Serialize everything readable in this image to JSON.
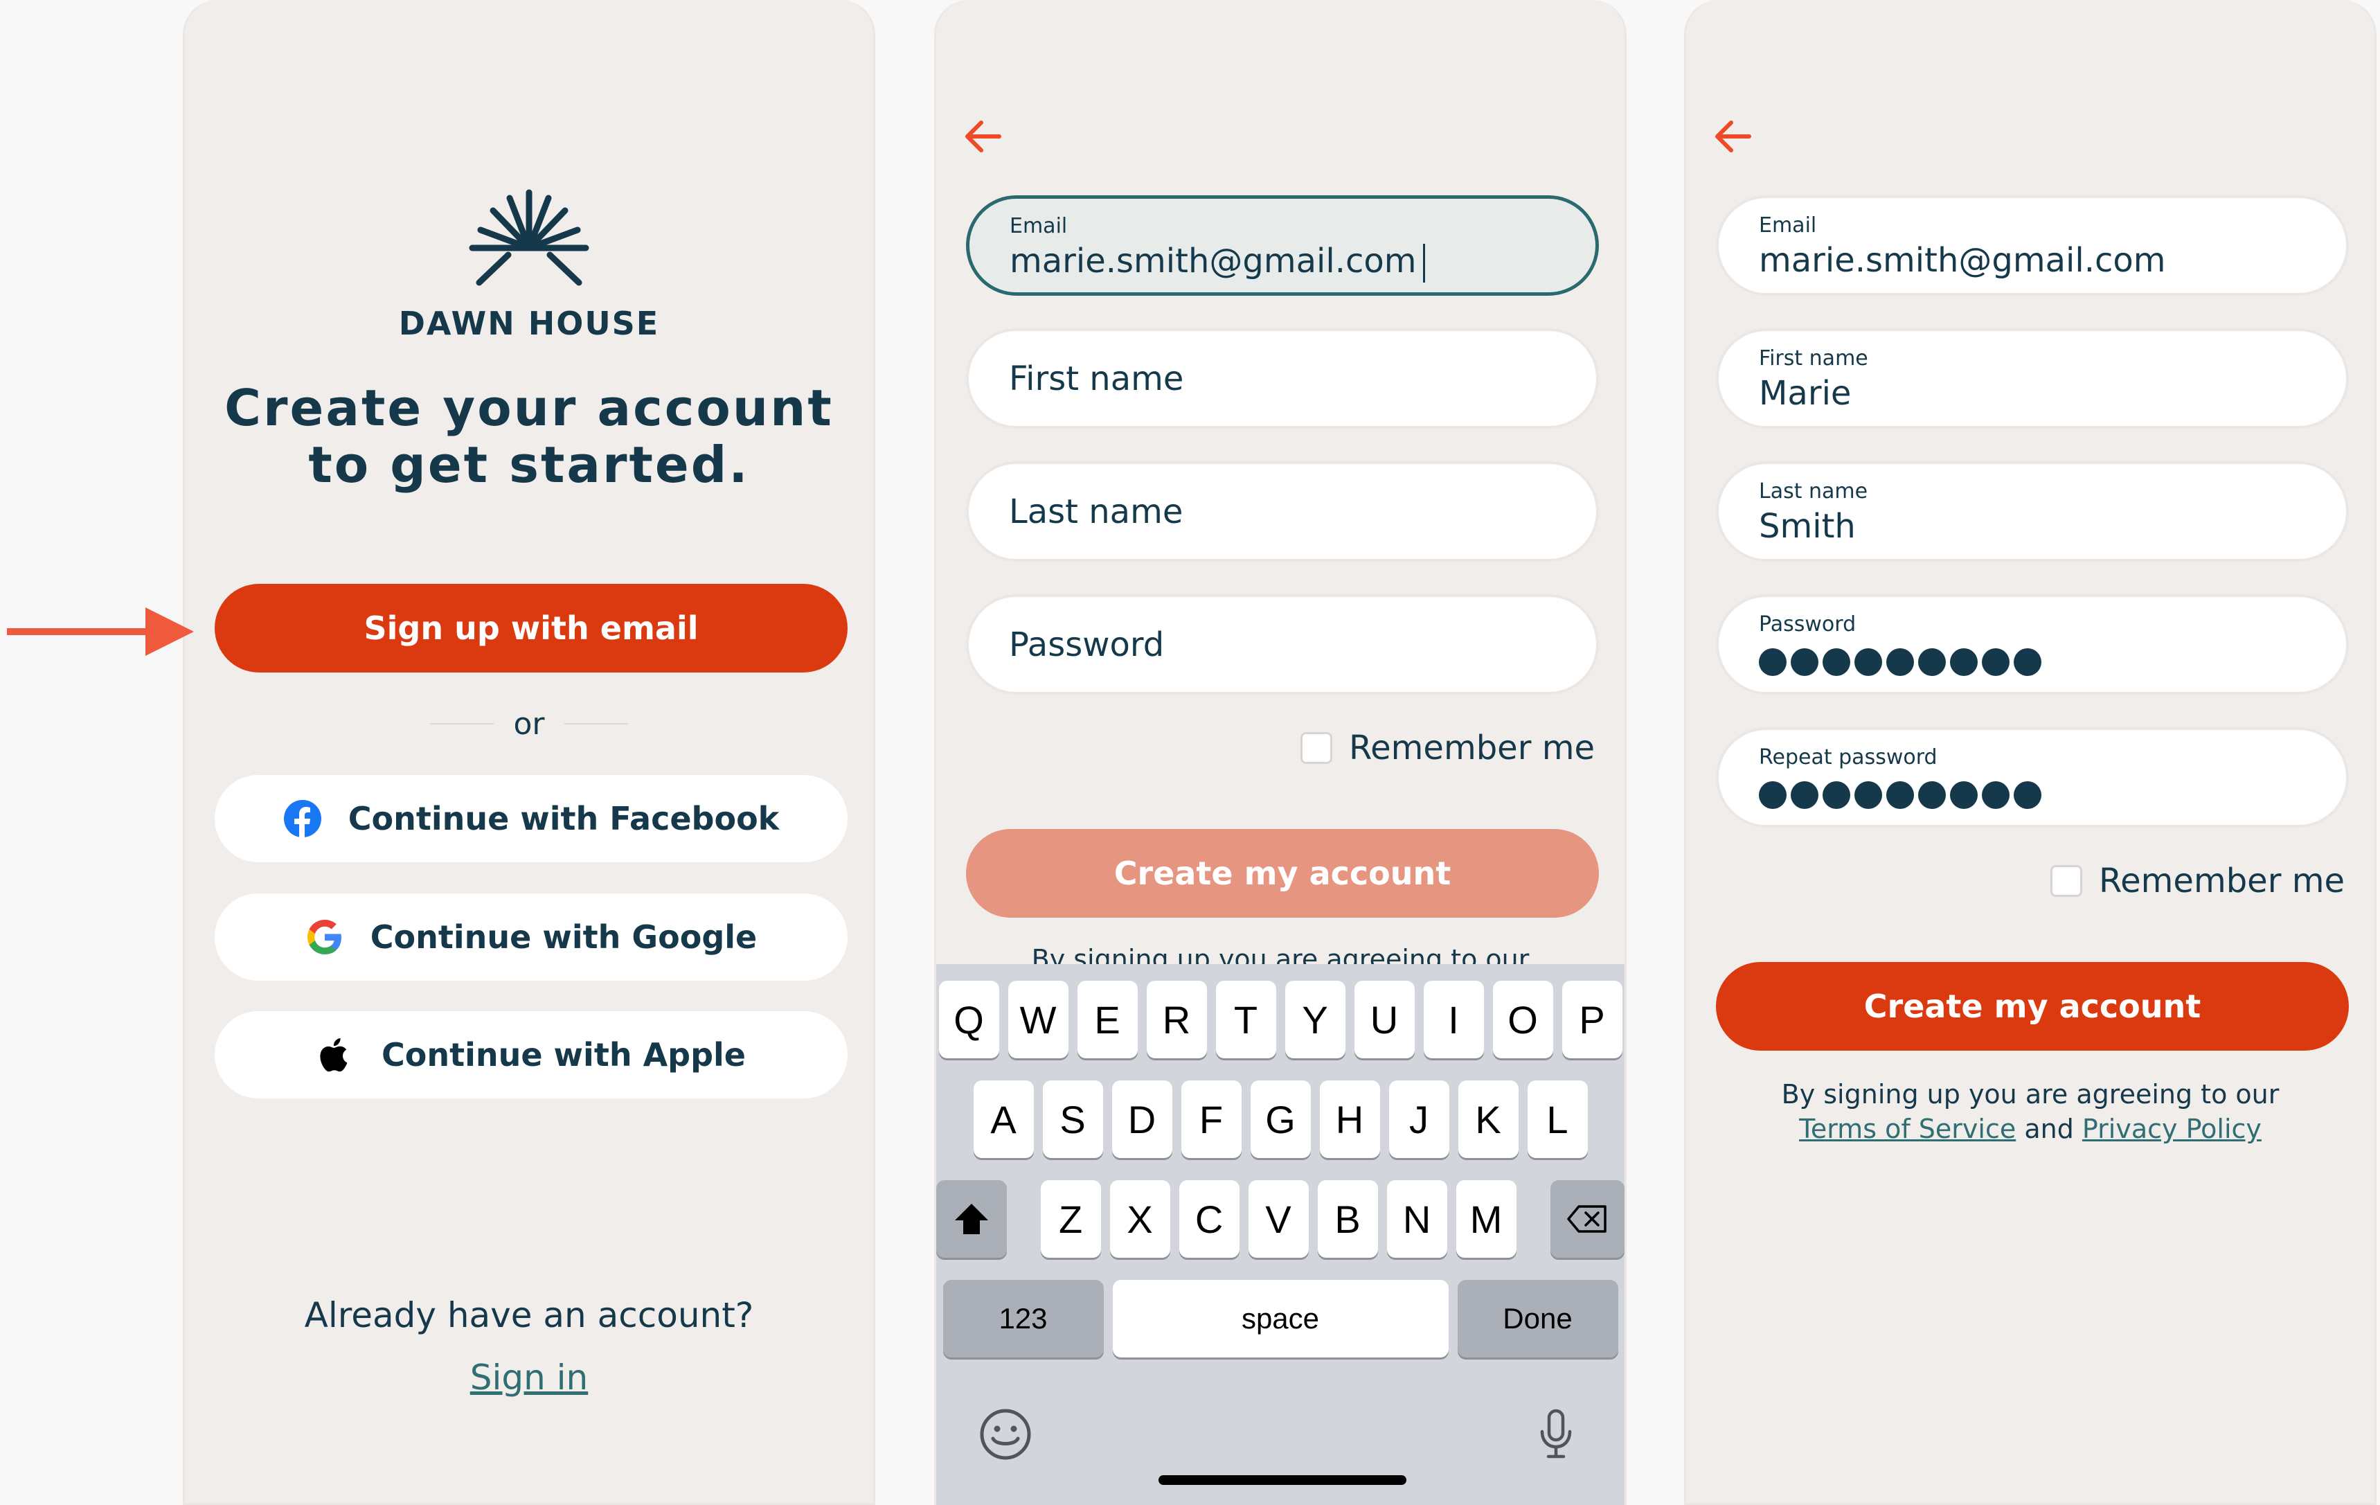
{
  "colors": {
    "accent": "#db3a10",
    "accent_disabled": "#e69581",
    "navy": "#15394a",
    "teal_link": "#2f6e73",
    "screen_bg": "#f1edeb"
  },
  "screen1": {
    "brand": "DAWN HOUSE",
    "headline_line1": "Create your account",
    "headline_line2": "to get started.",
    "signup_email": "Sign up with email",
    "or": "or",
    "facebook": "Continue with Facebook",
    "google": "Continue with Google",
    "apple": "Continue with Apple",
    "already": "Already have an account?",
    "signin": "Sign in"
  },
  "screen2": {
    "email_label": "Email",
    "email_value": "marie.smith@gmail.com",
    "first_name_placeholder": "First name",
    "last_name_placeholder": "Last name",
    "password_placeholder": "Password",
    "remember": "Remember me",
    "create": "Create my account",
    "terms_partial": "By signing up you are agreeing to our",
    "keyboard": {
      "row1": [
        "Q",
        "W",
        "E",
        "R",
        "T",
        "Y",
        "U",
        "I",
        "O",
        "P"
      ],
      "row2": [
        "A",
        "S",
        "D",
        "F",
        "G",
        "H",
        "J",
        "K",
        "L"
      ],
      "row3": [
        "Z",
        "X",
        "C",
        "V",
        "B",
        "N",
        "M"
      ],
      "numbers": "123",
      "space": "space",
      "done": "Done"
    }
  },
  "screen3": {
    "email_label": "Email",
    "email_value": "marie.smith@gmail.com",
    "first_label": "First name",
    "first_value": "Marie",
    "last_label": "Last name",
    "last_value": "Smith",
    "password_label": "Password",
    "repeat_label": "Repeat password",
    "remember": "Remember me",
    "create": "Create my account",
    "terms_line1": "By signing up you are agreeing to our",
    "terms_link1": "Terms of Service",
    "terms_and": "and",
    "terms_link2": "Privacy Policy"
  }
}
